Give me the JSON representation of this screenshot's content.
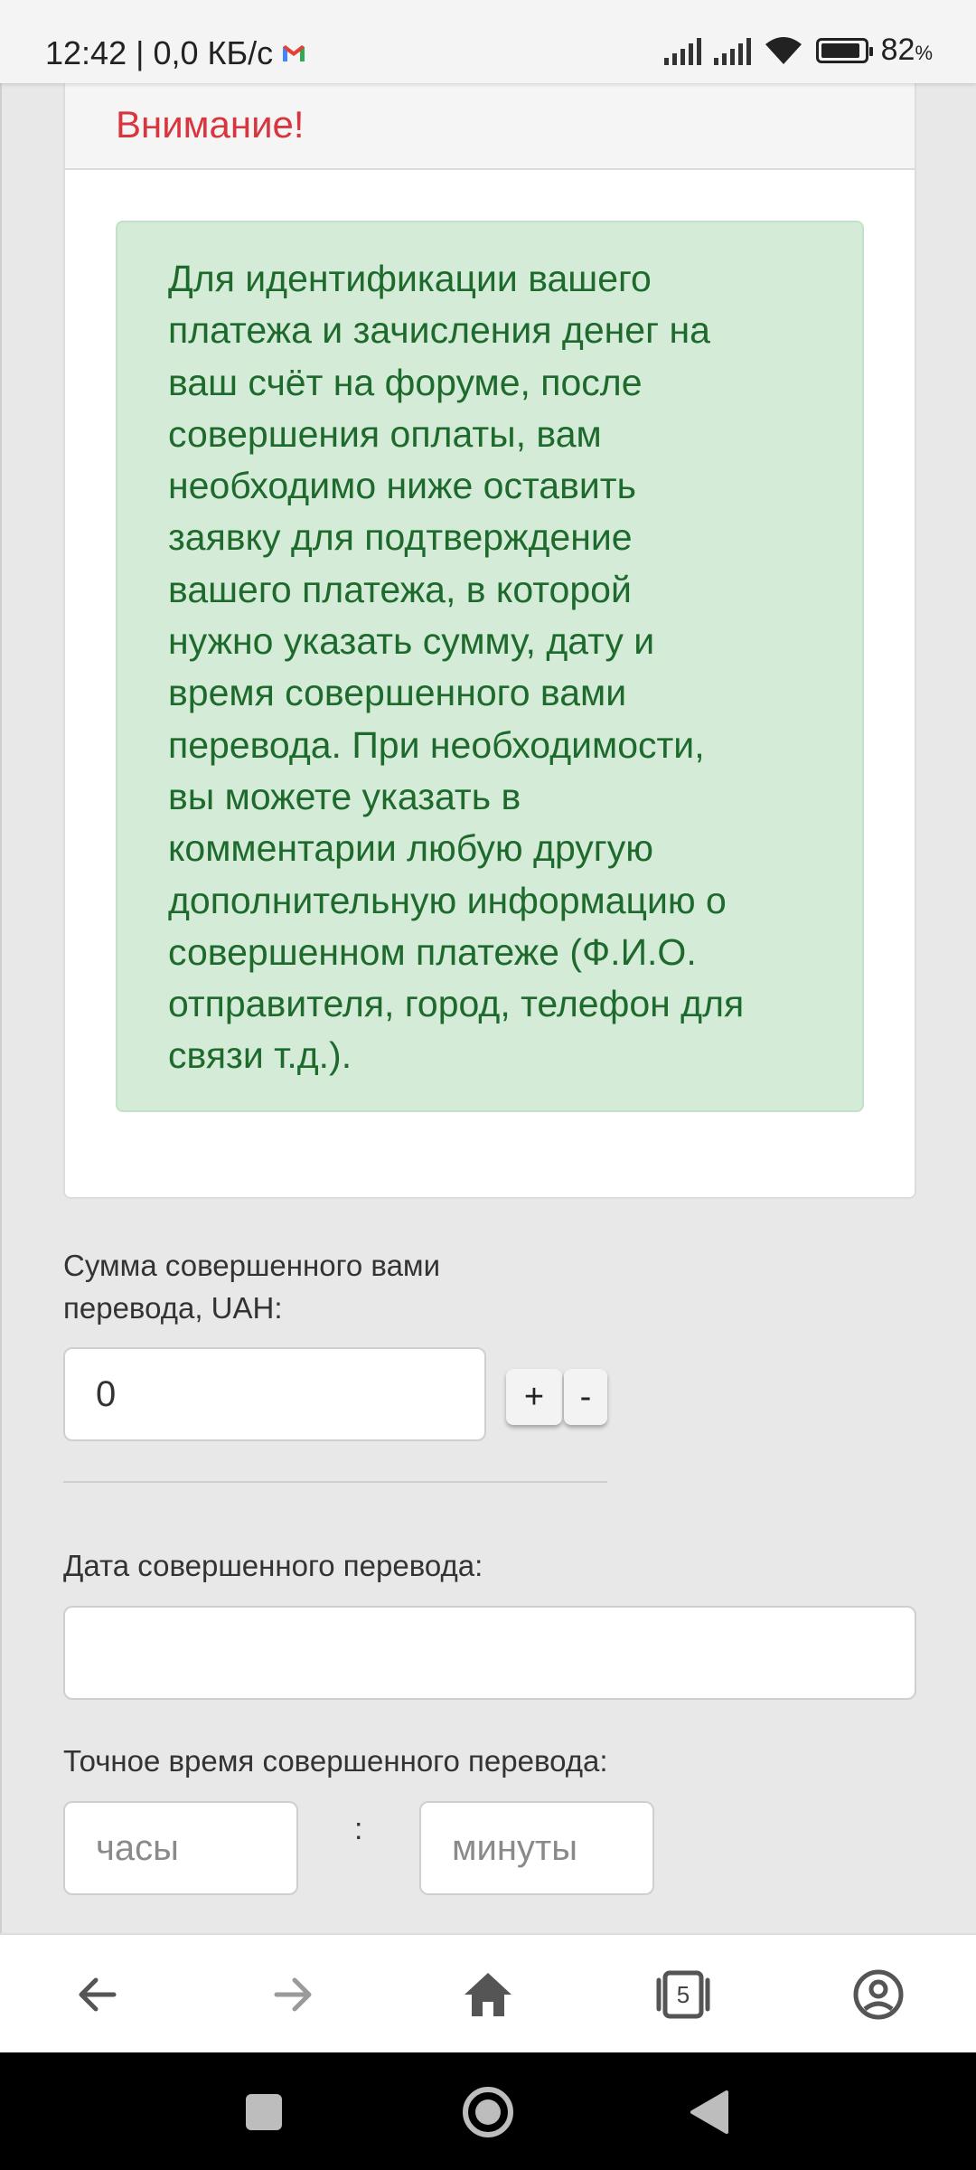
{
  "status_bar": {
    "time_speed": "12:42 | 0,0 КБ/с",
    "battery_pct": "82",
    "battery_unit": "%",
    "notification_icon": "gmail-icon"
  },
  "card": {
    "header": "Внимание!",
    "alert_text": "Для идентификации вашего платежа и зачисления денег на ваш счёт на форуме, после совершения оплаты, вам необходимо ниже оставить заявку для подтверждение вашего платежа, в которой нужно указать сумму, дату и время совершенного вами перевода. При необходимости, вы можете указать в комментарии любую другую дополнительную информацию о совершенном платеже (Ф.И.О. отправителя, город, телефон для связи т.д.).",
    "alert_lines": [
      "Для идентификации вашего",
      "платежа и зачисления денег на",
      "ваш счёт на форуме, после",
      "совершения оплаты, вам",
      "необходимо ниже оставить",
      "заявку для подтверждение",
      "вашего платежа, в которой",
      "нужно указать сумму, дату и",
      "время совершенного вами",
      "перевода. При необходимости,",
      "вы можете указать в",
      "комментарии любую другую",
      "дополнительную информацию о",
      "совершенном платеже (Ф.И.О.",
      "отправителя, город, телефон для",
      "связи т.д.)."
    ]
  },
  "form": {
    "amount_label_line1": "Сумма совершенного вами",
    "amount_label_line2": "перевода, UAH:",
    "amount_value": "0",
    "plus_label": "+",
    "minus_label": "-",
    "date_label": "Дата совершенного перевода:",
    "date_value": "",
    "time_label": "Точное время совершенного перевода:",
    "hours_placeholder": "часы",
    "minutes_placeholder": "минуты",
    "time_separator": ":"
  },
  "browser_nav": {
    "tabs_count": "5",
    "icons": [
      "back-arrow-icon",
      "forward-arrow-icon",
      "home-icon",
      "tabs-icon",
      "account-icon"
    ]
  },
  "system_nav": {
    "icons": [
      "recents-square-icon",
      "home-circle-icon",
      "back-triangle-icon"
    ]
  },
  "colors": {
    "warning_red": "#d9353f",
    "alert_bg": "#d4ebd8",
    "alert_text": "#1e6a2c"
  }
}
